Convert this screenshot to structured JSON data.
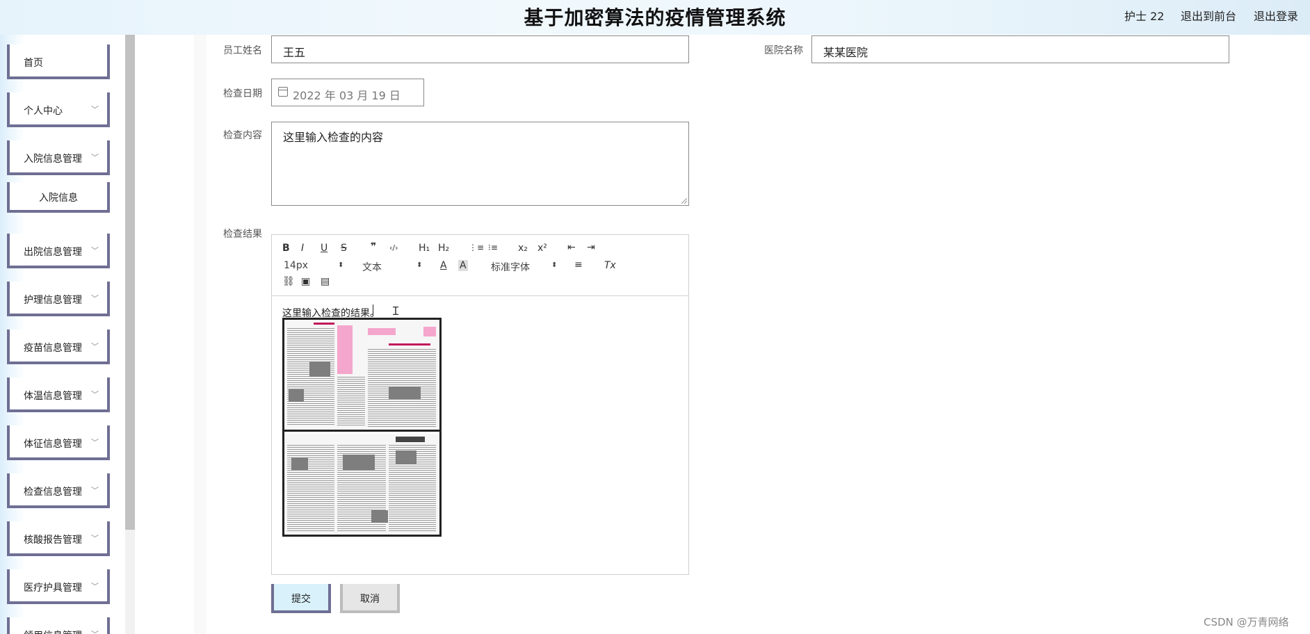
{
  "header": {
    "title": "基于加密算法的疫情管理系统",
    "user_label": "护士 22",
    "to_front_label": "退出到前台",
    "logout_label": "退出登录"
  },
  "sidebar": {
    "items": [
      {
        "label": "首页",
        "has_chevron": false
      },
      {
        "label": "个人中心",
        "has_chevron": true
      },
      {
        "label": "入院信息管理",
        "has_chevron": true
      },
      {
        "label": "入院信息",
        "sub": true
      },
      {
        "label": "出院信息管理",
        "has_chevron": true
      },
      {
        "label": "护理信息管理",
        "has_chevron": true
      },
      {
        "label": "疫苗信息管理",
        "has_chevron": true
      },
      {
        "label": "体温信息管理",
        "has_chevron": true
      },
      {
        "label": "体征信息管理",
        "has_chevron": true
      },
      {
        "label": "检查信息管理",
        "has_chevron": true
      },
      {
        "label": "核酸报告管理",
        "has_chevron": true
      },
      {
        "label": "医疗护具管理",
        "has_chevron": true
      },
      {
        "label": "领用信息管理",
        "has_chevron": true
      }
    ]
  },
  "form": {
    "employee_name_label": "员工姓名",
    "employee_name_value": "王五",
    "hospital_name_label": "医院名称",
    "hospital_name_value": "某某医院",
    "check_date_label": "检查日期",
    "check_date_value": "2022 年 03 月 19 日",
    "check_content_label": "检查内容",
    "check_content_value": "这里输入检查的内容",
    "check_result_label": "检查结果",
    "check_result_text": "这里输入检查的结果。"
  },
  "editor_toolbar": {
    "bold": "B",
    "italic": "I",
    "underline": "U",
    "strike": "S",
    "quote": "❞",
    "code": "‹/›",
    "h1": "H₁",
    "h2": "H₂",
    "ordered_list": "⋮≡",
    "bullet_list": "⁝≡",
    "subscript": "x₂",
    "superscript": "x²",
    "outdent": "⇤",
    "indent": "⇥",
    "font_size": "14px",
    "paragraph_type": "文本",
    "font_color": "A",
    "bg_color": "A",
    "font_family": "标准字体",
    "align": "≡",
    "clear_format": "Tx",
    "link": "⛓",
    "image": "▣",
    "video": "▤"
  },
  "buttons": {
    "submit": "提交",
    "cancel": "取消"
  },
  "watermark": "CSDN @万青网络"
}
